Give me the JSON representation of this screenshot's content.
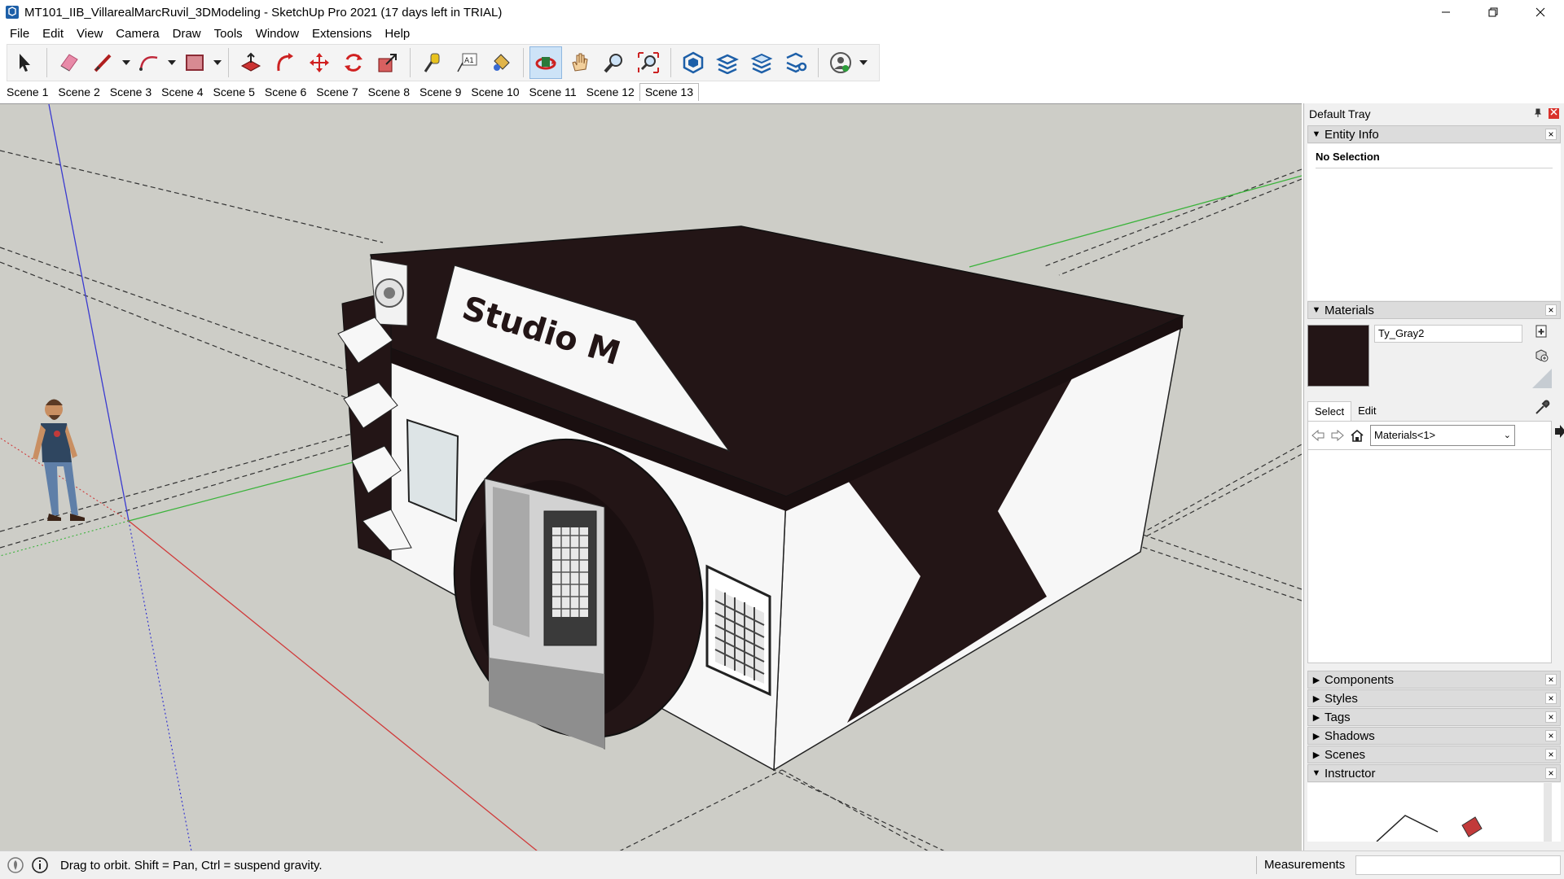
{
  "window": {
    "title": "MT101_IIB_VillarealMarcRuvil_3DModeling - SketchUp Pro 2021 (17 days left in TRIAL)"
  },
  "menu": [
    "File",
    "Edit",
    "View",
    "Camera",
    "Draw",
    "Tools",
    "Window",
    "Extensions",
    "Help"
  ],
  "toolbar": {
    "tools": [
      {
        "name": "select-icon"
      },
      {
        "name": "eraser-icon"
      },
      {
        "name": "line-icon"
      },
      {
        "name": "arc-icon"
      },
      {
        "name": "rectangle-icon"
      },
      {
        "name": "push-pull-icon"
      },
      {
        "name": "follow-me-icon"
      },
      {
        "name": "move-icon"
      },
      {
        "name": "rotate-icon"
      },
      {
        "name": "scale-icon"
      },
      {
        "name": "tape-measure-icon"
      },
      {
        "name": "text-icon"
      },
      {
        "name": "paint-bucket-icon"
      },
      {
        "name": "orbit-icon",
        "active": true
      },
      {
        "name": "pan-icon"
      },
      {
        "name": "zoom-icon"
      },
      {
        "name": "zoom-extents-icon"
      },
      {
        "name": "3d-warehouse-icon"
      },
      {
        "name": "extension-warehouse-icon"
      },
      {
        "name": "layout-icon"
      },
      {
        "name": "extension-manager-icon"
      },
      {
        "name": "profile-icon"
      }
    ]
  },
  "scenes": {
    "tabs": [
      "Scene 1",
      "Scene 2",
      "Scene 3",
      "Scene 4",
      "Scene 5",
      "Scene 6",
      "Scene 7",
      "Scene 8",
      "Scene 9",
      "Scene 10",
      "Scene 11",
      "Scene 12",
      "Scene 13"
    ],
    "active_index": 12
  },
  "model": {
    "sign_text": "Studio M"
  },
  "tray": {
    "title": "Default Tray",
    "entity_info": {
      "title": "Entity Info",
      "selection": "No Selection"
    },
    "materials": {
      "title": "Materials",
      "current_name": "Ty_Gray2",
      "swatch_color": "#231516",
      "tab_select": "Select",
      "tab_edit": "Edit",
      "collection": "Materials<1>"
    },
    "collapsed_panels": [
      "Components",
      "Styles",
      "Tags",
      "Shadows",
      "Scenes"
    ],
    "instructor": {
      "title": "Instructor"
    }
  },
  "statusbar": {
    "hint": "Drag to orbit. Shift = Pan, Ctrl = suspend gravity.",
    "measurements_label": "Measurements",
    "measurements_value": ""
  },
  "colors": {
    "viewport_bg": "#cdcdc7",
    "building_dark": "#231516",
    "wall_white": "#f7f7f7",
    "axis_red": "#d03a3a",
    "axis_green": "#3bb33b",
    "axis_blue": "#3a3ad0"
  }
}
